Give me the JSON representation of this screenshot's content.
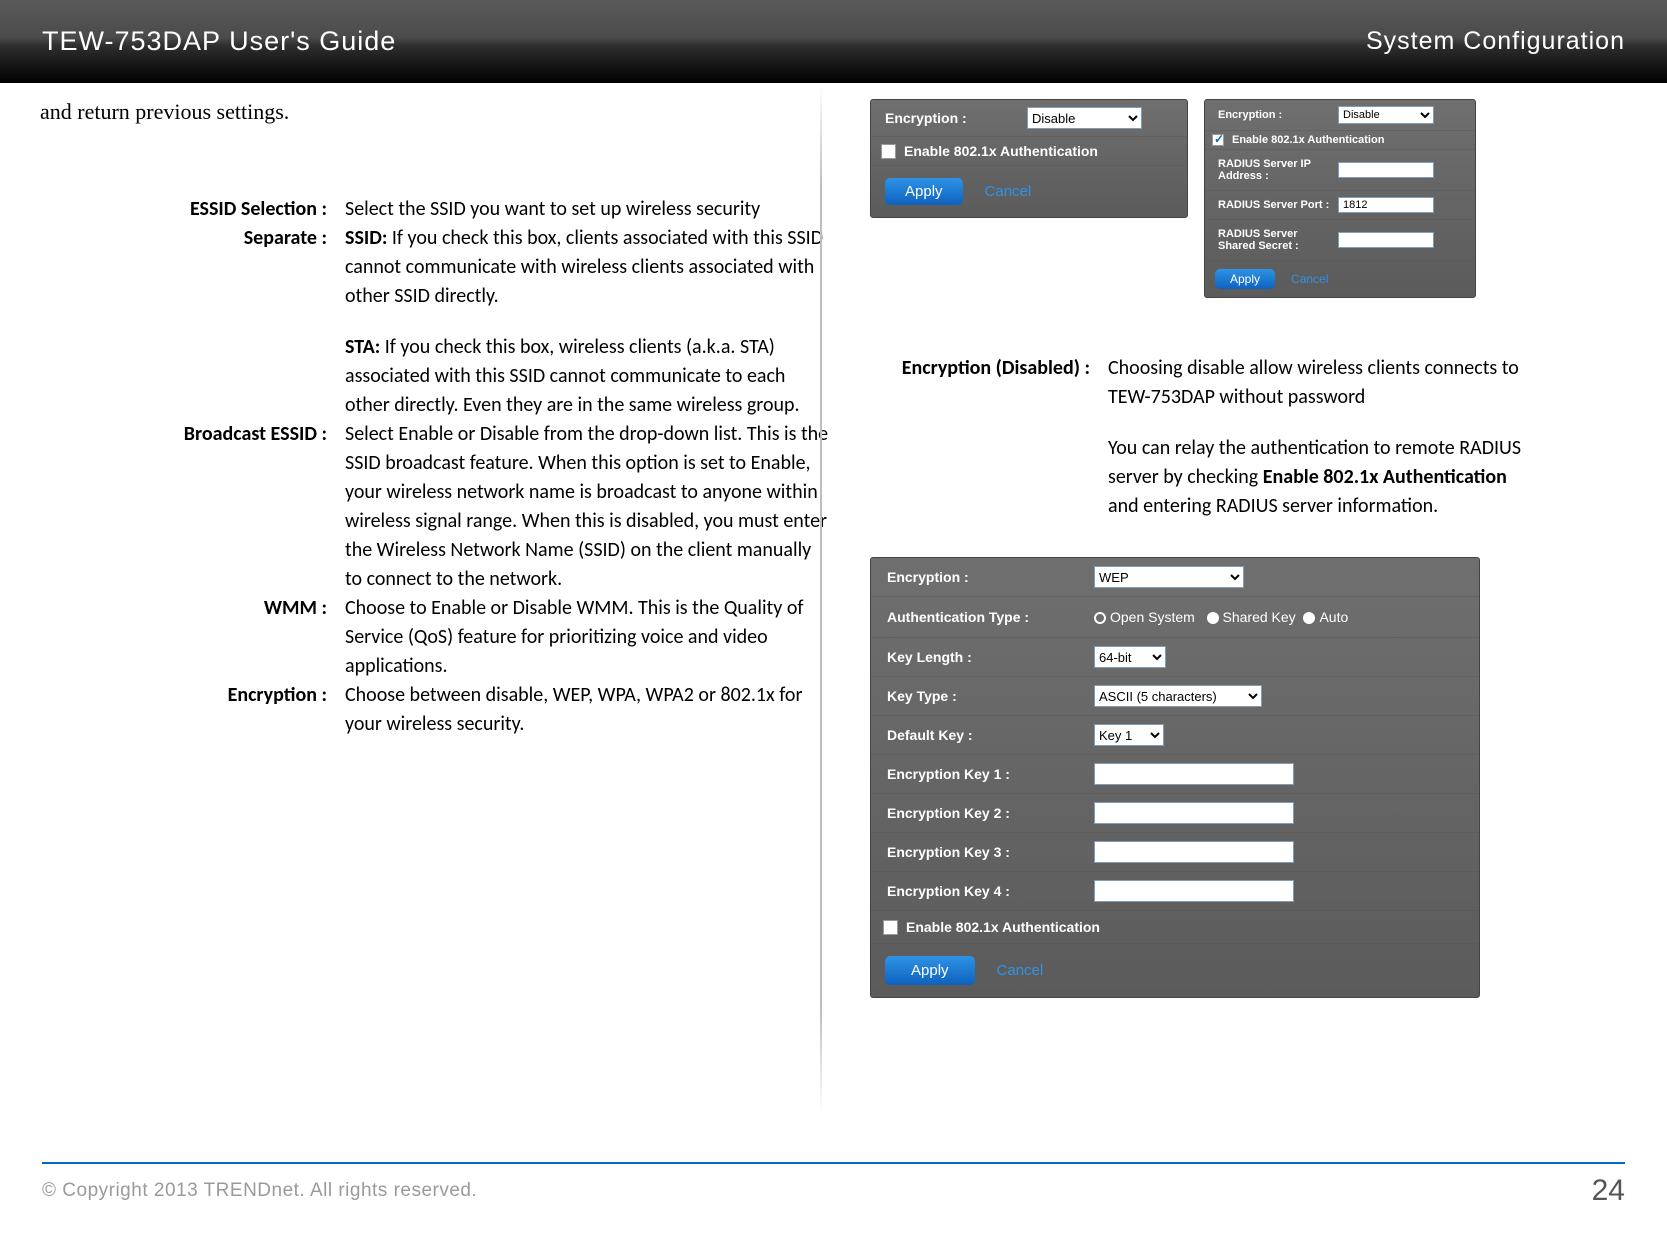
{
  "header": {
    "title": "TEW-753DAP User's Guide",
    "section": "System Configuration"
  },
  "intro": "and return previous settings.",
  "defs_left": {
    "essid_label": "ESSID Selection :",
    "essid_text": "Select the SSID you want to set up wireless security",
    "separate_label": "Separate :",
    "separate_ssid_bold": "SSID:",
    "separate_ssid_text": " If you check this box, clients associated with this SSID cannot communicate with wireless clients associated with other SSID directly.",
    "separate_sta_bold": "STA:",
    "separate_sta_text": " If you check this box, wireless clients (a.k.a. STA) associated with this SSID cannot communicate to each other directly. Even they are in the same wireless group.",
    "broadcast_label": "Broadcast ESSID :",
    "broadcast_text": "Select Enable or Disable from the drop-down list. This is the SSID broadcast feature. When this option is set to Enable, your wireless network name is broadcast to anyone within wireless signal range. When this is disabled, you must enter the Wireless Network Name (SSID) on the client manually to connect to the network.",
    "wmm_label": "WMM :",
    "wmm_text": "Choose to Enable or Disable WMM. This is the Quality of Service (QoS) feature for prioritizing voice and video applications.",
    "enc_label": "Encryption :",
    "enc_text": "Choose between disable, WEP, WPA, WPA2 or 802.1x for your wireless security."
  },
  "defs_right": {
    "encd_label": "Encryption (Disabled) :",
    "encd_text1": "Choosing disable allow wireless clients connects to TEW-753DAP without password",
    "encd_text2a": "You can relay the authentication to remote RADIUS server by checking ",
    "encd_bold": "Enable 802.1x Authentication",
    "encd_text2b": " and entering RADIUS server information."
  },
  "panel1": {
    "enc_label": "Encryption :",
    "enc_value": "Disable",
    "chk_label": "Enable 802.1x Authentication",
    "apply": "Apply",
    "cancel": "Cancel"
  },
  "panel2": {
    "enc_label": "Encryption :",
    "enc_value": "Disable",
    "chk_label": "Enable 802.1x Authentication",
    "radius_ip_label": "RADIUS Server IP Address :",
    "radius_port_label": "RADIUS Server Port :",
    "radius_port_value": "1812",
    "radius_secret_label": "RADIUS Server Shared Secret :",
    "apply": "Apply",
    "cancel": "Cancel"
  },
  "panel3": {
    "enc_label": "Encryption :",
    "enc_value": "WEP",
    "auth_label": "Authentication Type :",
    "auth_open": "Open System",
    "auth_shared": "Shared Key",
    "auth_auto": "Auto",
    "keylen_label": "Key Length :",
    "keylen_value": "64-bit",
    "keytype_label": "Key Type :",
    "keytype_value": "ASCII (5 characters)",
    "defkey_label": "Default Key :",
    "defkey_value": "Key 1",
    "k1": "Encryption Key 1 :",
    "k2": "Encryption Key 2 :",
    "k3": "Encryption Key 3 :",
    "k4": "Encryption Key 4 :",
    "chk_label": "Enable 802.1x Authentication",
    "apply": "Apply",
    "cancel": "Cancel"
  },
  "footer": {
    "copyright": "© Copyright 2013 TRENDnet. All rights reserved.",
    "page": "24"
  }
}
